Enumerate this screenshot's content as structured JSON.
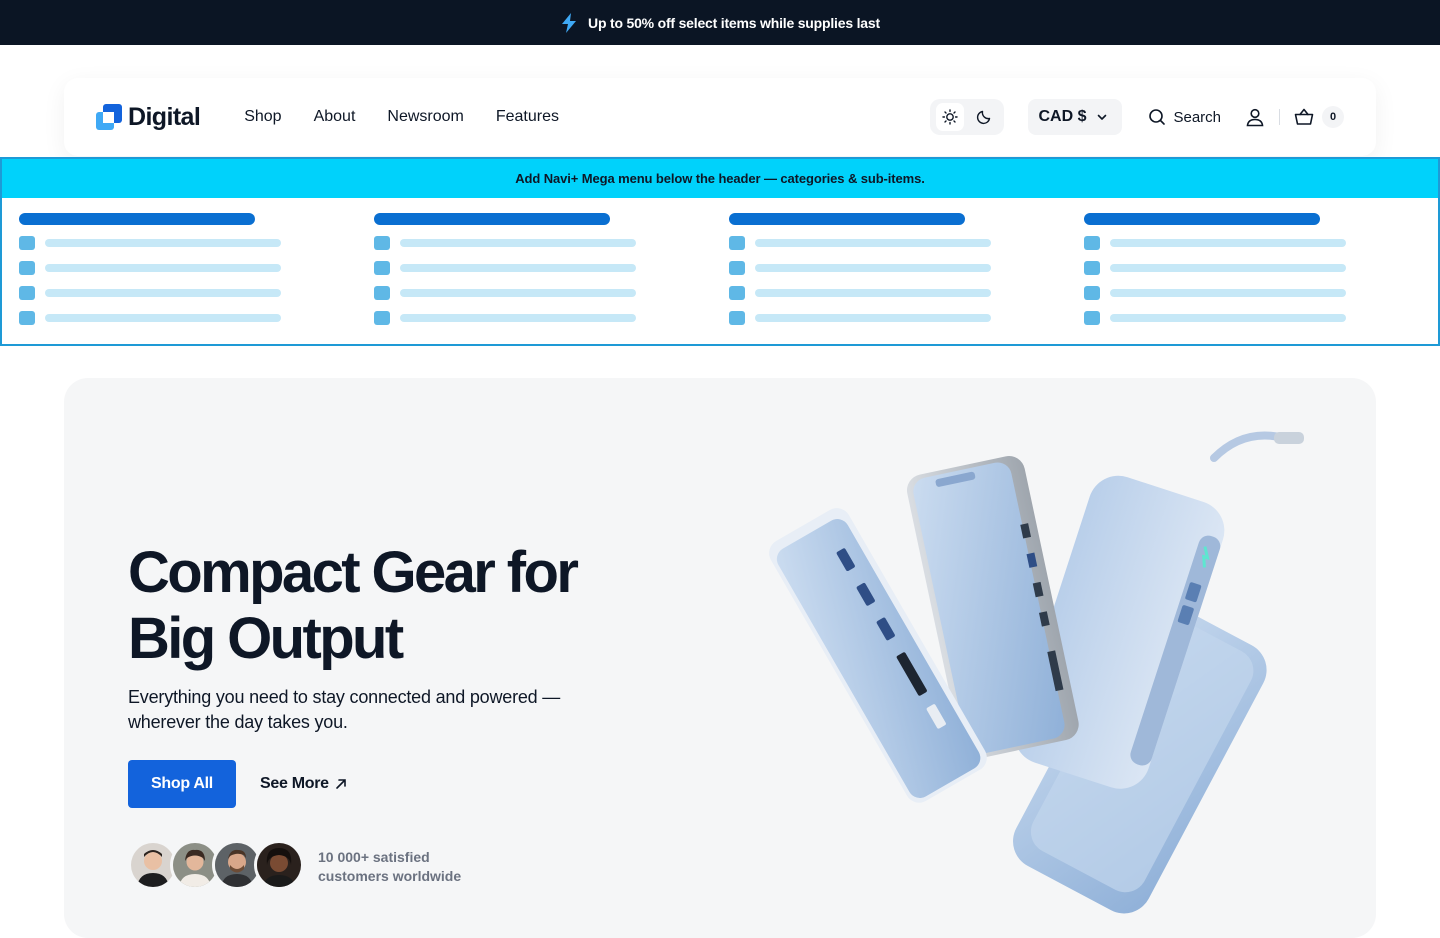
{
  "announcement": {
    "icon": "lightning-bolt-icon",
    "text": "Up to 50% off select items while supplies last"
  },
  "header": {
    "logo_text": "Digital",
    "nav": [
      {
        "label": "Shop"
      },
      {
        "label": "About"
      },
      {
        "label": "Newsroom"
      },
      {
        "label": "Features"
      }
    ],
    "currency_label": "CAD $",
    "search_label": "Search",
    "cart_count": "0"
  },
  "mega_menu": {
    "banner_text": "Add Navi+ Mega menu below the header — categories & sub-items.",
    "columns": 4,
    "rows_per_column": 4
  },
  "hero": {
    "title_line1": "Compact Gear for",
    "title_line2": "Big Output",
    "subtitle": "Everything you need to stay connected and powered — wherever the day takes you.",
    "primary_button": "Shop All",
    "secondary_link": "See More",
    "social_proof_line1": "10 000+ satisfied",
    "social_proof_line2": "customers worldwide"
  },
  "colors": {
    "announcement_bg": "#0b1524",
    "primary": "#1363dc",
    "mega_banner": "#00d2fb",
    "mega_border": "#1e9ad6",
    "hero_bg": "#f5f6f7",
    "product_blue": "#a9c3e3"
  }
}
